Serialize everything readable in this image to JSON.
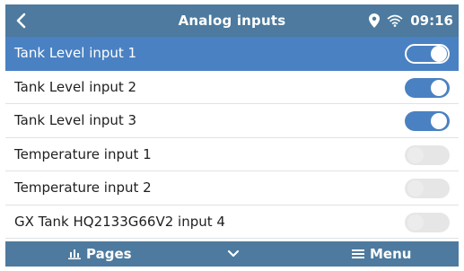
{
  "header": {
    "title": "Analog inputs",
    "time": "09:16",
    "icons": [
      "back-chevron-icon",
      "location-pin-icon",
      "wifi-icon"
    ]
  },
  "inputs": [
    {
      "label": "Tank Level input 1",
      "enabled": true,
      "selected": true
    },
    {
      "label": "Tank Level input 2",
      "enabled": true,
      "selected": false
    },
    {
      "label": "Tank Level input 3",
      "enabled": true,
      "selected": false
    },
    {
      "label": "Temperature input 1",
      "enabled": false,
      "selected": false
    },
    {
      "label": "Temperature input 2",
      "enabled": false,
      "selected": false
    },
    {
      "label": "GX Tank HQ2133G66V2 input 4",
      "enabled": false,
      "selected": false
    }
  ],
  "footer": {
    "pages_label": "Pages",
    "menu_label": "Menu",
    "icons": [
      "pages-icon",
      "chevron-down-icon",
      "menu-icon"
    ]
  },
  "colors": {
    "header_bg": "#4d7a9e",
    "selected_row": "#4a81c2",
    "toggle_on": "#4a81c2",
    "toggle_off": "#e6e6e6"
  }
}
